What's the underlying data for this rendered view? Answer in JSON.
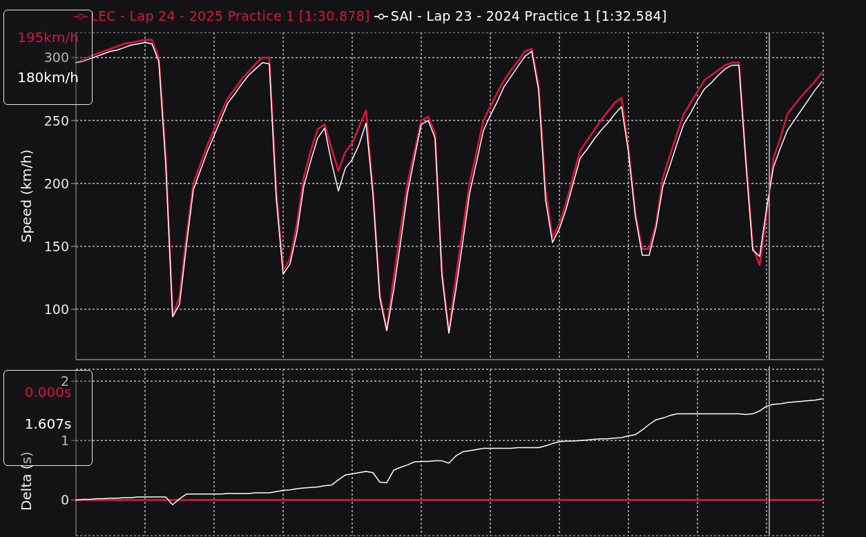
{
  "speed_chart": {
    "tooltip": [
      {
        "text": "195km/h",
        "color": "#dc143c"
      },
      {
        "text": "180km/h",
        "color": "#ffffff"
      }
    ],
    "chart_data": {
      "type": "line",
      "grid": true,
      "ylabel": "Speed (km/h)",
      "ylim": [
        60,
        320
      ],
      "yticks": [
        100,
        150,
        200,
        250,
        300
      ],
      "categories": [
        null,
        null,
        null,
        null,
        null,
        null,
        null,
        null,
        null,
        null,
        null,
        null,
        null,
        null,
        null,
        null,
        null,
        null,
        null,
        null,
        null,
        null,
        null,
        null,
        null,
        null,
        null,
        null,
        null,
        null,
        null,
        null,
        null,
        null,
        null,
        null,
        null,
        null,
        null,
        null,
        null,
        null,
        null,
        null,
        null,
        null,
        null,
        null,
        null,
        null,
        null,
        null,
        null,
        null,
        null,
        null,
        null,
        null,
        null,
        null,
        null,
        null,
        null,
        null,
        null,
        null,
        null,
        null,
        null,
        null,
        null,
        null,
        null,
        null,
        null,
        null,
        null,
        null,
        null,
        null,
        null,
        null,
        null,
        null,
        null,
        null,
        null,
        null,
        null,
        null,
        null,
        null,
        null,
        null,
        null,
        null,
        null,
        null,
        null,
        null,
        null,
        null,
        null,
        null,
        null,
        null,
        null,
        null,
        null
      ],
      "series": [
        {
          "name": "LEC - Lap 24 - 2025 Practice 1 [1:30.878]",
          "color": "#dc143c",
          "values": [
            296,
            298,
            301,
            303,
            305,
            307,
            309,
            311,
            312,
            313,
            314,
            314,
            300,
            222,
            95,
            110,
            158,
            200,
            215,
            230,
            243,
            256,
            268,
            275,
            283,
            289,
            295,
            300,
            300,
            195,
            131,
            140,
            168,
            205,
            226,
            243,
            247,
            228,
            210,
            225,
            232,
            245,
            258,
            195,
            112,
            84,
            125,
            163,
            200,
            225,
            250,
            253,
            240,
            130,
            82,
            125,
            163,
            200,
            225,
            250,
            261,
            272,
            282,
            290,
            297,
            305,
            307,
            278,
            195,
            157,
            168,
            185,
            206,
            226,
            234,
            242,
            250,
            257,
            264,
            268,
            228,
            176,
            148,
            148,
            168,
            205,
            222,
            239,
            255,
            264,
            273,
            282,
            286,
            290,
            294,
            296,
            296,
            220,
            150,
            135,
            175,
            220,
            236,
            255,
            262,
            269,
            275,
            281,
            288
          ]
        },
        {
          "name": "SAI - Lap 23 - 2024 Practice 1 [1:32.584]",
          "color": "#ffffff",
          "values": [
            296,
            297,
            299,
            301,
            303,
            305,
            306,
            308,
            310,
            311,
            312,
            311,
            297,
            215,
            94,
            104,
            151,
            195,
            210,
            225,
            238,
            251,
            264,
            271,
            279,
            286,
            291,
            296,
            295,
            188,
            128,
            136,
            161,
            198,
            218,
            236,
            244,
            217,
            194,
            212,
            219,
            231,
            248,
            192,
            109,
            83,
            115,
            153,
            192,
            220,
            247,
            250,
            236,
            126,
            81,
            115,
            153,
            192,
            217,
            242,
            254,
            265,
            277,
            285,
            293,
            301,
            305,
            274,
            187,
            153,
            164,
            180,
            200,
            220,
            227,
            235,
            242,
            248,
            255,
            261,
            225,
            174,
            143,
            143,
            165,
            198,
            214,
            231,
            247,
            256,
            266,
            275,
            280,
            286,
            291,
            294,
            294,
            217,
            147,
            142,
            180,
            213,
            228,
            242,
            250,
            258,
            266,
            274,
            281
          ]
        }
      ]
    }
  },
  "delta_chart": {
    "tooltip": [
      {
        "text": "0.000s",
        "color": "#dc143c"
      },
      {
        "text": "1.607s",
        "color": "#ffffff"
      }
    ],
    "chart_data": {
      "type": "line",
      "grid": true,
      "ylabel": "Delta (s)",
      "ylim": [
        -0.6,
        2.2
      ],
      "yticks": [
        0,
        1,
        2
      ],
      "categories": [
        null,
        null,
        null,
        null,
        null,
        null,
        null,
        null,
        null,
        null,
        null,
        null,
        null,
        null,
        null,
        null,
        null,
        null,
        null,
        null,
        null,
        null,
        null,
        null,
        null,
        null,
        null,
        null,
        null,
        null,
        null,
        null,
        null,
        null,
        null,
        null,
        null,
        null,
        null,
        null,
        null,
        null,
        null,
        null,
        null,
        null,
        null,
        null,
        null,
        null,
        null,
        null,
        null,
        null,
        null,
        null,
        null,
        null,
        null,
        null,
        null,
        null,
        null,
        null,
        null,
        null,
        null,
        null,
        null,
        null,
        null,
        null,
        null,
        null,
        null,
        null,
        null,
        null,
        null,
        null,
        null,
        null,
        null,
        null,
        null,
        null,
        null,
        null,
        null,
        null,
        null,
        null,
        null,
        null,
        null,
        null,
        null,
        null,
        null,
        null,
        null,
        null,
        null,
        null,
        null,
        null,
        null,
        null,
        null
      ],
      "series": [
        {
          "color": "#dc143c",
          "values": [
            0,
            0,
            0,
            0,
            0,
            0,
            0,
            0,
            0,
            0,
            0,
            0,
            0,
            0,
            0,
            0,
            0,
            0,
            0,
            0,
            0,
            0,
            0,
            0,
            0,
            0,
            0,
            0,
            0,
            0,
            0,
            0,
            0,
            0,
            0,
            0,
            0,
            0,
            0,
            0,
            0,
            0,
            0,
            0,
            0,
            0,
            0,
            0,
            0,
            0,
            0,
            0,
            0,
            0,
            0,
            0,
            0,
            0,
            0,
            0,
            0,
            0,
            0,
            0,
            0,
            0,
            0,
            0,
            0,
            0,
            0,
            0,
            0,
            0,
            0,
            0,
            0,
            0,
            0,
            0,
            0,
            0,
            0,
            0,
            0,
            0,
            0,
            0,
            0,
            0,
            0,
            0,
            0,
            0,
            0,
            0,
            0,
            0,
            0,
            0,
            0,
            0,
            0,
            0,
            0,
            0,
            0,
            0,
            0
          ]
        },
        {
          "color": "#ffffff",
          "values": [
            0,
            0.01,
            0.01,
            0.02,
            0.02,
            0.03,
            0.03,
            0.04,
            0.04,
            0.05,
            0.05,
            0.05,
            0.05,
            0.05,
            -0.08,
            0.02,
            0.1,
            0.1,
            0.1,
            0.1,
            0.1,
            0.1,
            0.11,
            0.11,
            0.11,
            0.11,
            0.12,
            0.12,
            0.12,
            0.14,
            0.16,
            0.17,
            0.19,
            0.2,
            0.21,
            0.22,
            0.24,
            0.25,
            0.34,
            0.42,
            0.44,
            0.46,
            0.48,
            0.46,
            0.3,
            0.29,
            0.5,
            0.55,
            0.59,
            0.64,
            0.65,
            0.65,
            0.66,
            0.66,
            0.62,
            0.74,
            0.81,
            0.83,
            0.85,
            0.87,
            0.87,
            0.87,
            0.87,
            0.87,
            0.88,
            0.88,
            0.88,
            0.88,
            0.91,
            0.95,
            0.98,
            0.99,
            0.99,
            1.0,
            1.01,
            1.02,
            1.03,
            1.03,
            1.04,
            1.05,
            1.08,
            1.1,
            1.18,
            1.27,
            1.35,
            1.38,
            1.42,
            1.45,
            1.45,
            1.45,
            1.45,
            1.45,
            1.45,
            1.45,
            1.45,
            1.45,
            1.45,
            1.44,
            1.45,
            1.5,
            1.58,
            1.61,
            1.62,
            1.64,
            1.65,
            1.66,
            1.67,
            1.68,
            1.7
          ]
        }
      ]
    }
  }
}
